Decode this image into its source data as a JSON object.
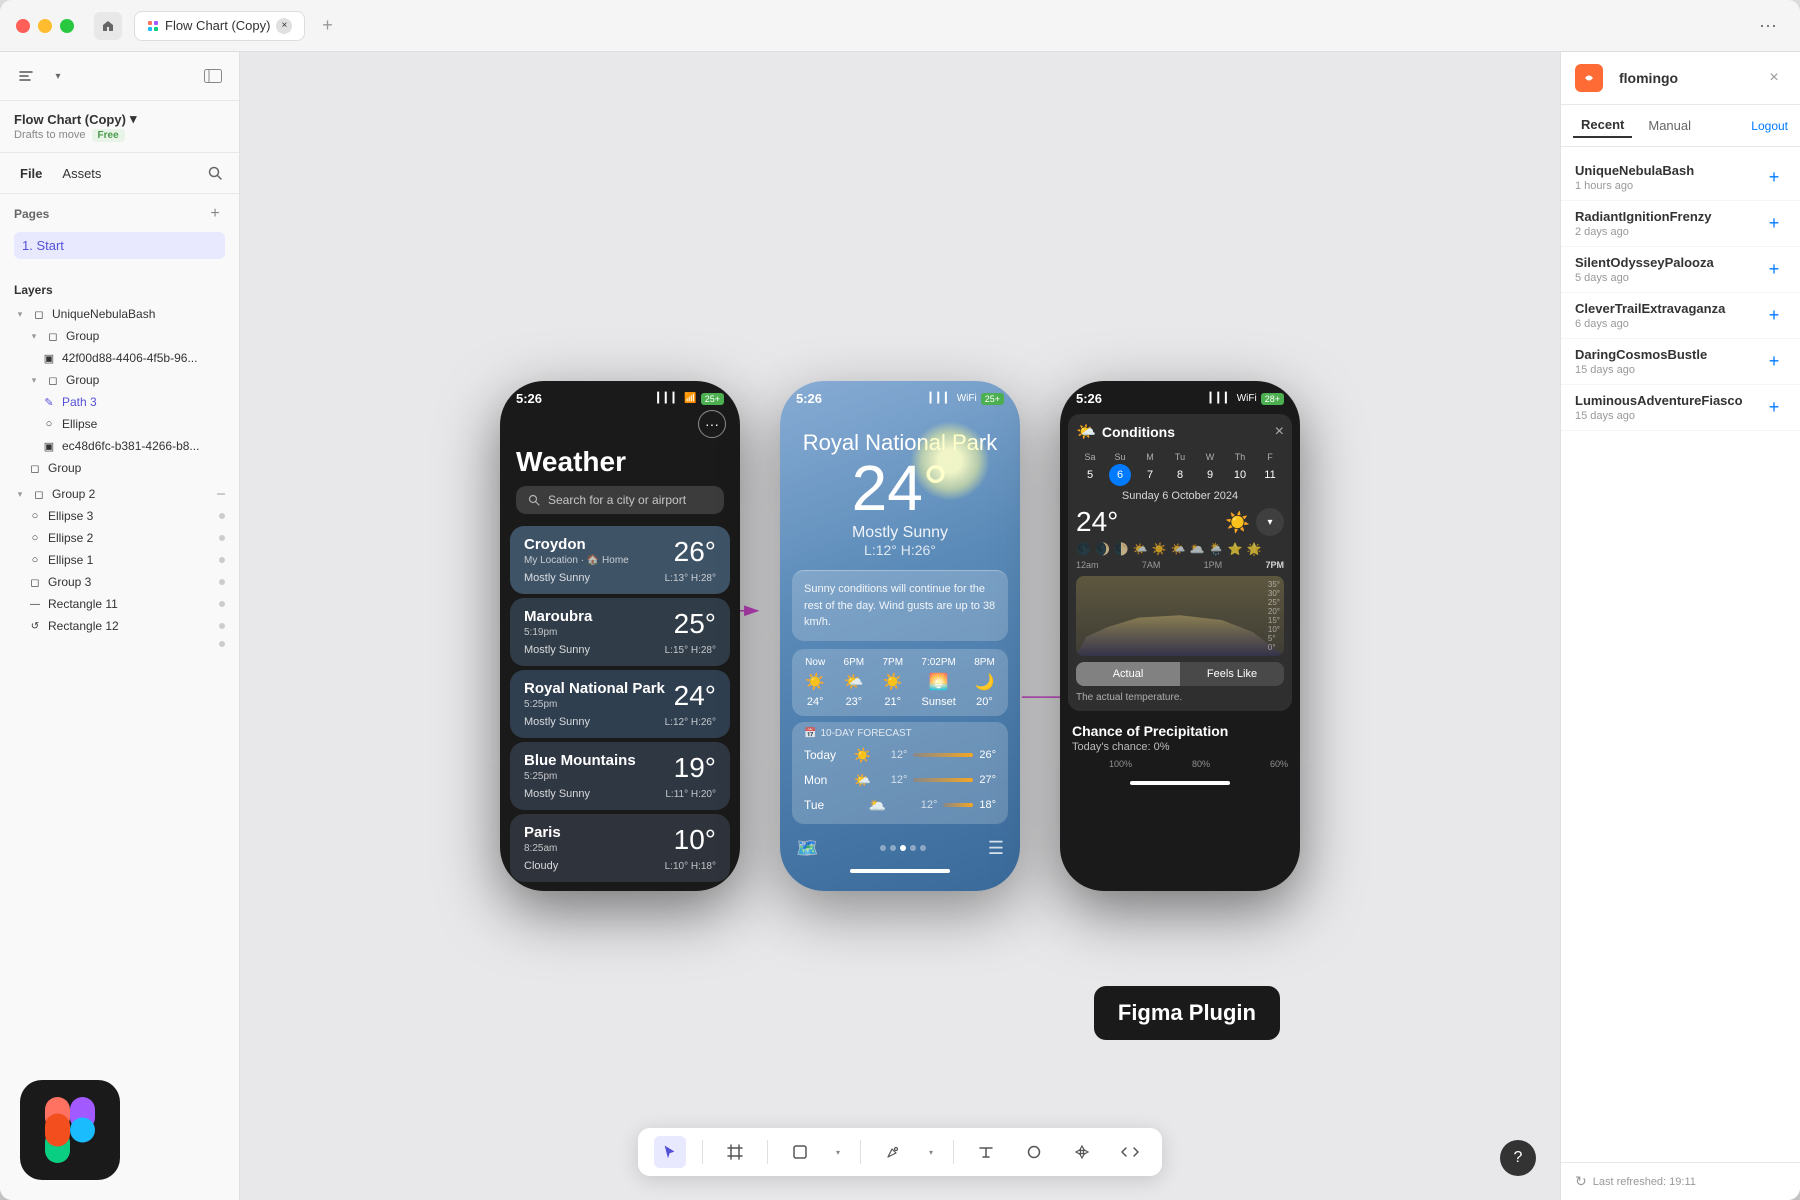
{
  "window": {
    "title": "Flow Chart (Copy)",
    "tab_icon": "figma-icon"
  },
  "titlebar": {
    "home_label": "⌂",
    "tab_name": "Flow Chart (Copy)",
    "tab_close": "×",
    "add_tab": "+",
    "more_options": "···"
  },
  "sidebar": {
    "tools_label": "tools",
    "panel_toggle": "panel",
    "project_name": "Flow Chart (Copy)",
    "project_arrow": "▾",
    "drafts_label": "Drafts to move",
    "free_badge": "Free",
    "file_tab": "File",
    "assets_tab": "Assets",
    "search_icon": "🔍",
    "pages_title": "Pages",
    "pages_add": "+",
    "pages": [
      {
        "name": "1. Start",
        "active": true
      }
    ],
    "layers_title": "Layers",
    "layers": [
      {
        "name": "UniqueNebulaBash",
        "indent": 0,
        "icon": "◻",
        "has_toggle": true,
        "toggle": "▾"
      },
      {
        "name": "Group",
        "indent": 1,
        "icon": "◻",
        "has_toggle": true,
        "toggle": "▾"
      },
      {
        "name": "42f00d88-4406-4f5b-96...",
        "indent": 2,
        "icon": "▣",
        "has_dot": false
      },
      {
        "name": "Group",
        "indent": 1,
        "icon": "◻",
        "has_toggle": true,
        "toggle": "▾"
      },
      {
        "name": "Path 3",
        "indent": 2,
        "icon": "✎"
      },
      {
        "name": "Ellipse",
        "indent": 2,
        "icon": "○"
      },
      {
        "name": "ec48d6fc-b381-4266-b8...",
        "indent": 2,
        "icon": "▣"
      },
      {
        "name": "Group",
        "indent": 1,
        "icon": "◻",
        "has_toggle": false
      },
      {
        "name": "Group 2",
        "indent": 0,
        "icon": "◻",
        "has_toggle": true,
        "toggle": "▾"
      },
      {
        "name": "Ellipse 3",
        "indent": 1,
        "icon": "○",
        "has_dot": true
      },
      {
        "name": "Ellipse 2",
        "indent": 1,
        "icon": "○",
        "has_dot": true
      },
      {
        "name": "Ellipse 1",
        "indent": 1,
        "icon": "○",
        "has_dot": true
      },
      {
        "name": "Group 3",
        "indent": 1,
        "icon": "◻",
        "has_dot": true
      },
      {
        "name": "Rectangle 11",
        "indent": 1,
        "icon": "—",
        "has_dot": true
      },
      {
        "name": "Rectangle 12",
        "indent": 1,
        "icon": "↺",
        "has_dot": true
      },
      {
        "name": "",
        "indent": 1,
        "icon": "",
        "has_dot": true
      }
    ]
  },
  "phone1": {
    "time": "5:26",
    "title": "Weather",
    "search_placeholder": "Search for a city or airport",
    "cities": [
      {
        "name": "Croydon",
        "meta": "My Location · 🏠 Home",
        "temp": "26°",
        "desc": "Mostly Sunny",
        "low": "L:13°",
        "high": "H:28°"
      },
      {
        "name": "Maroubra",
        "meta": "5:19pm",
        "temp": "25°",
        "desc": "Mostly Sunny",
        "low": "L:15°",
        "high": "H:28°"
      },
      {
        "name": "Royal National Park",
        "meta": "5:25pm",
        "temp": "24°",
        "desc": "Mostly Sunny",
        "low": "L:12°",
        "high": "H:26°",
        "selected": true
      },
      {
        "name": "Blue Mountains",
        "meta": "5:25pm",
        "temp": "19°",
        "desc": "Mostly Sunny",
        "low": "L:11°",
        "high": "H:20°"
      },
      {
        "name": "Paris",
        "meta": "8:25am",
        "temp": "10°",
        "desc": "Cloudy",
        "low": "L:10°",
        "high": "H:18°"
      }
    ]
  },
  "phone2": {
    "time": "5:26",
    "location": "Royal National Park",
    "temp": "24°",
    "desc": "Mostly Sunny",
    "range": "L:12° H:26°",
    "summary": "Sunny conditions will continue for the rest of the day. Wind gusts are up to 38 km/h.",
    "hourly": [
      {
        "time": "Now",
        "icon": "☀️",
        "temp": "24°"
      },
      {
        "time": "6PM",
        "icon": "🌤️",
        "temp": "23°"
      },
      {
        "time": "7PM",
        "icon": "☀️",
        "temp": "21°"
      },
      {
        "time": "7:02PM",
        "icon": "🌅",
        "temp": "Sunset"
      },
      {
        "time": "8PM",
        "icon": "🌙",
        "temp": "20°"
      }
    ],
    "forecast_title": "10-DAY FORECAST",
    "forecast": [
      {
        "day": "Today",
        "icon": "☀️",
        "low": "12°",
        "high": "26°",
        "selected": true
      },
      {
        "day": "Mon",
        "icon": "🌤️",
        "low": "12°",
        "high": "27°"
      },
      {
        "day": "Tue",
        "icon": "🌥️",
        "low": "12°",
        "high": "18°"
      }
    ]
  },
  "phone3": {
    "time": "5:26",
    "conditions_title": "Conditions",
    "close_btn": "×",
    "calendar": {
      "days_labels": [
        "Sa",
        "Su",
        "M",
        "Tu",
        "W",
        "Th",
        "F"
      ],
      "days": [
        "5",
        "6",
        "7",
        "8",
        "9",
        "10",
        "11"
      ],
      "today": "6",
      "date_label": "Sunday 6 October 2024"
    },
    "temp": "24°",
    "temp_icon": "☀️",
    "moon_icons": [
      "🌑",
      "🌒",
      "🌓",
      "🌔",
      "☀️",
      "🌤️",
      "🌥️",
      "🌦️",
      "🌧️",
      "⭐",
      "🌟"
    ],
    "chart_times": [
      "12am",
      "7AM",
      "1PM",
      "7PM"
    ],
    "chart_temps": [
      "35°",
      "30°",
      "25°",
      "20°",
      "15°",
      "10°",
      "5°",
      "0°"
    ],
    "actual_label": "Actual",
    "feels_like_label": "Feels Like",
    "actual_desc": "The actual temperature.",
    "precip_title": "Chance of Precipitation",
    "precip_sub": "Today's chance: 0%",
    "precip_values": [
      "100%",
      "80%",
      "60%"
    ]
  },
  "plugin": {
    "logo_text": "f",
    "name": "flomingo",
    "close": "×",
    "tabs": [
      {
        "label": "Recent",
        "active": true
      },
      {
        "label": "Manual",
        "active": false
      }
    ],
    "logout_label": "Logout",
    "items": [
      {
        "name": "UniqueNebulaBash",
        "time": "1 hours ago"
      },
      {
        "name": "RadiantIgnitionFrenzy",
        "time": "2 days ago"
      },
      {
        "name": "SilentOdysseyPalooza",
        "time": "5 days ago"
      },
      {
        "name": "CleverTrailExtravaganza",
        "time": "6 days ago"
      },
      {
        "name": "DaringCosmosBustle",
        "time": "15 days ago"
      },
      {
        "name": "LuminousAdventureFiasco",
        "time": "15 days ago"
      }
    ],
    "add_btn": "+",
    "refresh_icon": "↻",
    "refresh_label": "Last refreshed: 19:11"
  },
  "figma_plugin_tooltip": "Figma Plugin",
  "bottom_toolbar": {
    "tools": [
      {
        "name": "cursor",
        "icon": "↖",
        "active": true
      },
      {
        "name": "frame",
        "icon": "⊞"
      },
      {
        "name": "rectangle",
        "icon": "□"
      },
      {
        "name": "pen",
        "icon": "✒"
      },
      {
        "name": "text",
        "icon": "T"
      },
      {
        "name": "ellipse",
        "icon": "○"
      },
      {
        "name": "components",
        "icon": "⊕"
      },
      {
        "name": "code",
        "icon": "</>"
      }
    ]
  },
  "help_btn": "?",
  "colors": {
    "accent": "#5551d6",
    "blue": "#007AFF",
    "sidebar_bg": "#f9f9f9",
    "canvas_bg": "#e8e8ea"
  }
}
